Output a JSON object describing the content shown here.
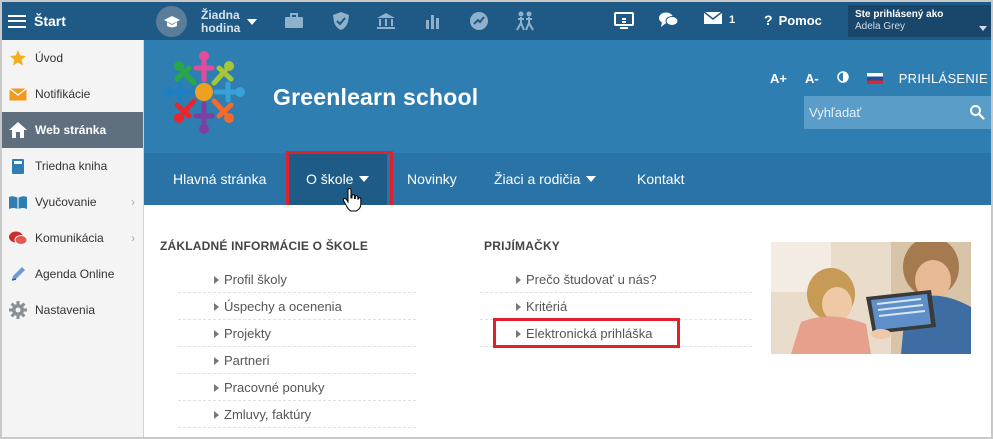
{
  "topbar": {
    "start_label": "Štart",
    "class_label_line1": "Žiadna",
    "class_label_line2": "hodina",
    "message_count": "1",
    "help_label": "Pomoc",
    "user_title": "Ste prihlásený ako",
    "user_name": "Adela Grey"
  },
  "sidebar": {
    "items": [
      {
        "label": "Úvod",
        "icon": "star-icon"
      },
      {
        "label": "Notifikácie",
        "icon": "envelope-icon"
      },
      {
        "label": "Web stránka",
        "icon": "home-icon"
      },
      {
        "label": "Triedna kniha",
        "icon": "book-icon"
      },
      {
        "label": "Vyučovanie",
        "icon": "open-book-icon"
      },
      {
        "label": "Komunikácia",
        "icon": "chat-icon"
      },
      {
        "label": "Agenda Online",
        "icon": "pen-icon"
      },
      {
        "label": "Nastavenia",
        "icon": "gear-icon"
      }
    ],
    "active_index": 2
  },
  "site": {
    "school_name": "Greenlearn school",
    "font_increase": "A+",
    "font_decrease": "A-",
    "login_label": "PRIHLÁSENIE",
    "search_placeholder": "Vyhľadať"
  },
  "nav": {
    "items": [
      "Hlavná stránka",
      "O škole",
      "Novinky",
      "Žiaci a rodičia",
      "Kontakt"
    ]
  },
  "dropdown": {
    "col1_title": "ZÁKLADNÉ INFORMÁCIE O ŠKOLE",
    "col1_items": [
      "Profil školy",
      "Úspechy a ocenenia",
      "Projekty",
      "Partneri",
      "Pracovné ponuky",
      "Zmluvy, faktúry"
    ],
    "col2_title": "PRIJÍMAČKY",
    "col2_items": [
      "Prečo študovať u nás?",
      "Kritériá",
      "Elektronická prihláška"
    ]
  },
  "colors": {
    "topbar": "#1f5a86",
    "header": "#2f7eb2",
    "nav": "#2a73a6",
    "highlight": "#e0202a"
  }
}
